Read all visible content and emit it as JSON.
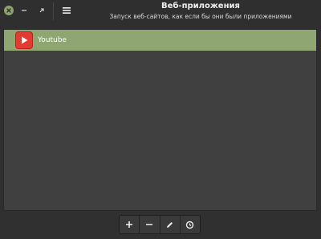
{
  "window": {
    "title": "Веб-приложения",
    "subtitle": "Запуск веб-сайтов, как если бы они были приложениями"
  },
  "apps": [
    {
      "name": "Youtube",
      "icon": "youtube-icon",
      "selected": true
    }
  ],
  "toolbar": [
    {
      "icon": "add-icon"
    },
    {
      "icon": "remove-icon"
    },
    {
      "icon": "edit-icon"
    },
    {
      "icon": "launch-icon"
    }
  ],
  "colors": {
    "selection": "#8fa673",
    "close": "#8da46e",
    "youtube": "#e23b32"
  }
}
